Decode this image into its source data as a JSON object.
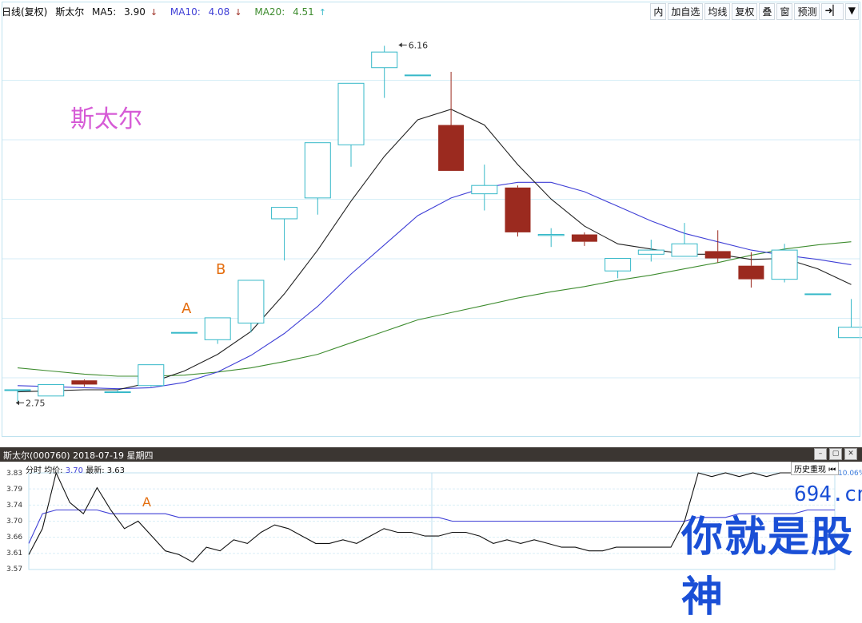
{
  "main_header": {
    "period": "日线(复权)",
    "stock": "斯太尔",
    "ma5_label": "MA5:",
    "ma5": "3.90",
    "ma5_arrow": "↓",
    "ma10_label": "MA10:",
    "ma10": "4.08",
    "ma10_arrow": "↓",
    "ma20_label": "MA20:",
    "ma20": "4.51",
    "ma20_arrow": "↑"
  },
  "toolbar": [
    "内",
    "加自选",
    "均线",
    "复权",
    "叠",
    "窗",
    "预测",
    "➜▏",
    "▼"
  ],
  "colors": {
    "up": "#35b8c8",
    "down": "#9b2a1f",
    "ma5": "#222222",
    "ma10": "#3f3fd6",
    "ma20": "#3e8c2f",
    "title": "#d65bd6",
    "annot": "#e46d0e"
  },
  "stock_title": "斯太尔",
  "annotations": {
    "a": "A",
    "b": "B",
    "intraday_a": "A"
  },
  "chart_data": [
    {
      "type": "candlestick",
      "title": "日线(复权)",
      "ylim": [
        2.4,
        6.4
      ],
      "high_label": "6.16",
      "low_label": "2.75",
      "candles": [
        {
          "o": 2.86,
          "c": 2.86,
          "h": 2.86,
          "l": 2.75
        },
        {
          "o": 2.8,
          "c": 2.91,
          "h": 2.91,
          "l": 2.8
        },
        {
          "o": 2.95,
          "c": 2.91,
          "h": 2.96,
          "l": 2.89
        },
        {
          "o": 2.84,
          "c": 2.84,
          "h": 2.86,
          "l": 2.84
        },
        {
          "o": 2.9,
          "c": 3.1,
          "h": 3.1,
          "l": 2.89
        },
        {
          "o": 3.41,
          "c": 3.41,
          "h": 3.41,
          "l": 3.41
        },
        {
          "o": 3.34,
          "c": 3.55,
          "h": 3.55,
          "l": 3.3
        },
        {
          "o": 3.5,
          "c": 3.91,
          "h": 3.91,
          "l": 3.41
        },
        {
          "o": 4.5,
          "c": 4.61,
          "h": 4.61,
          "l": 4.1
        },
        {
          "o": 4.7,
          "c": 5.23,
          "h": 5.23,
          "l": 4.54
        },
        {
          "o": 5.21,
          "c": 5.8,
          "h": 5.8,
          "l": 5.0
        },
        {
          "o": 5.95,
          "c": 6.1,
          "h": 6.16,
          "l": 5.66
        },
        {
          "o": 5.88,
          "c": 5.88,
          "h": 5.88,
          "l": 5.88
        },
        {
          "o": 5.4,
          "c": 4.96,
          "h": 5.91,
          "l": 4.96
        },
        {
          "o": 4.74,
          "c": 4.82,
          "h": 5.02,
          "l": 4.58
        },
        {
          "o": 4.8,
          "c": 4.37,
          "h": 4.82,
          "l": 4.33
        },
        {
          "o": 4.34,
          "c": 4.35,
          "h": 4.41,
          "l": 4.23
        },
        {
          "o": 4.35,
          "c": 4.28,
          "h": 4.37,
          "l": 4.24
        },
        {
          "o": 4.0,
          "c": 4.12,
          "h": 4.12,
          "l": 3.93
        },
        {
          "o": 4.16,
          "c": 4.2,
          "h": 4.3,
          "l": 4.09
        },
        {
          "o": 4.14,
          "c": 4.26,
          "h": 4.46,
          "l": 4.15
        },
        {
          "o": 4.19,
          "c": 4.12,
          "h": 4.39,
          "l": 4.08
        },
        {
          "o": 4.05,
          "c": 3.92,
          "h": 4.18,
          "l": 3.84
        },
        {
          "o": 3.92,
          "c": 4.2,
          "h": 4.26,
          "l": 3.89
        },
        {
          "o": 3.78,
          "c": 3.78,
          "h": 3.78,
          "l": 3.78
        },
        {
          "o": 3.36,
          "c": 3.46,
          "h": 3.73,
          "l": 3.46
        }
      ],
      "ma5": [
        2.84,
        2.85,
        2.86,
        2.86,
        2.93,
        3.04,
        3.2,
        3.42,
        3.78,
        4.2,
        4.67,
        5.1,
        5.45,
        5.55,
        5.4,
        5.02,
        4.69,
        4.43,
        4.26,
        4.21,
        4.16,
        4.16,
        4.11,
        4.12,
        4.02,
        3.87
      ],
      "ma10": [
        2.9,
        2.89,
        2.88,
        2.87,
        2.88,
        2.93,
        3.03,
        3.19,
        3.4,
        3.66,
        3.97,
        4.25,
        4.53,
        4.7,
        4.8,
        4.85,
        4.85,
        4.76,
        4.62,
        4.48,
        4.36,
        4.28,
        4.2,
        4.15,
        4.11,
        4.06
      ],
      "ma20": [
        3.07,
        3.04,
        3.01,
        2.99,
        2.99,
        3.0,
        3.03,
        3.07,
        3.13,
        3.2,
        3.31,
        3.42,
        3.53,
        3.6,
        3.67,
        3.74,
        3.8,
        3.85,
        3.91,
        3.96,
        4.02,
        4.08,
        4.15,
        4.21,
        4.25,
        4.28
      ]
    },
    {
      "type": "line",
      "title": "斯太尔(000760) 2018-07-19 星期四",
      "ylim": [
        3.57,
        3.83
      ],
      "yticks": [
        "3.83",
        "3.79",
        "3.74",
        "3.70",
        "3.66",
        "3.61",
        "3.57"
      ],
      "pct_label": "10.06%",
      "price": [
        3.61,
        3.68,
        3.83,
        3.75,
        3.72,
        3.79,
        3.73,
        3.68,
        3.7,
        3.66,
        3.62,
        3.61,
        3.59,
        3.63,
        3.62,
        3.65,
        3.64,
        3.67,
        3.69,
        3.68,
        3.66,
        3.64,
        3.64,
        3.65,
        3.64,
        3.66,
        3.68,
        3.67,
        3.67,
        3.66,
        3.66,
        3.67,
        3.67,
        3.66,
        3.64,
        3.65,
        3.64,
        3.65,
        3.64,
        3.63,
        3.63,
        3.62,
        3.62,
        3.63,
        3.63,
        3.63,
        3.63,
        3.63,
        3.7,
        3.83,
        3.82,
        3.83,
        3.82,
        3.83,
        3.82,
        3.83,
        3.83,
        3.83,
        3.83,
        3.83
      ],
      "avg": [
        3.64,
        3.72,
        3.73,
        3.73,
        3.73,
        3.73,
        3.72,
        3.72,
        3.72,
        3.72,
        3.72,
        3.71,
        3.71,
        3.71,
        3.71,
        3.71,
        3.71,
        3.71,
        3.71,
        3.71,
        3.71,
        3.71,
        3.71,
        3.71,
        3.71,
        3.71,
        3.71,
        3.71,
        3.71,
        3.71,
        3.71,
        3.7,
        3.7,
        3.7,
        3.7,
        3.7,
        3.7,
        3.7,
        3.7,
        3.7,
        3.7,
        3.7,
        3.7,
        3.7,
        3.7,
        3.7,
        3.7,
        3.7,
        3.7,
        3.71,
        3.71,
        3.71,
        3.72,
        3.72,
        3.72,
        3.72,
        3.72,
        3.73,
        3.73,
        3.73
      ]
    }
  ],
  "sub_header": {
    "title": "斯太尔(000760) 2018-07-19 星期四"
  },
  "intraday_legend": {
    "prefix": "分时",
    "avg_label": "均价:",
    "avg": "3.70",
    "last_label": "最新:",
    "last": "3.63"
  },
  "replay_label": "历史重现",
  "watermark": {
    "site": "694.cn",
    "text": "你就是股神"
  }
}
